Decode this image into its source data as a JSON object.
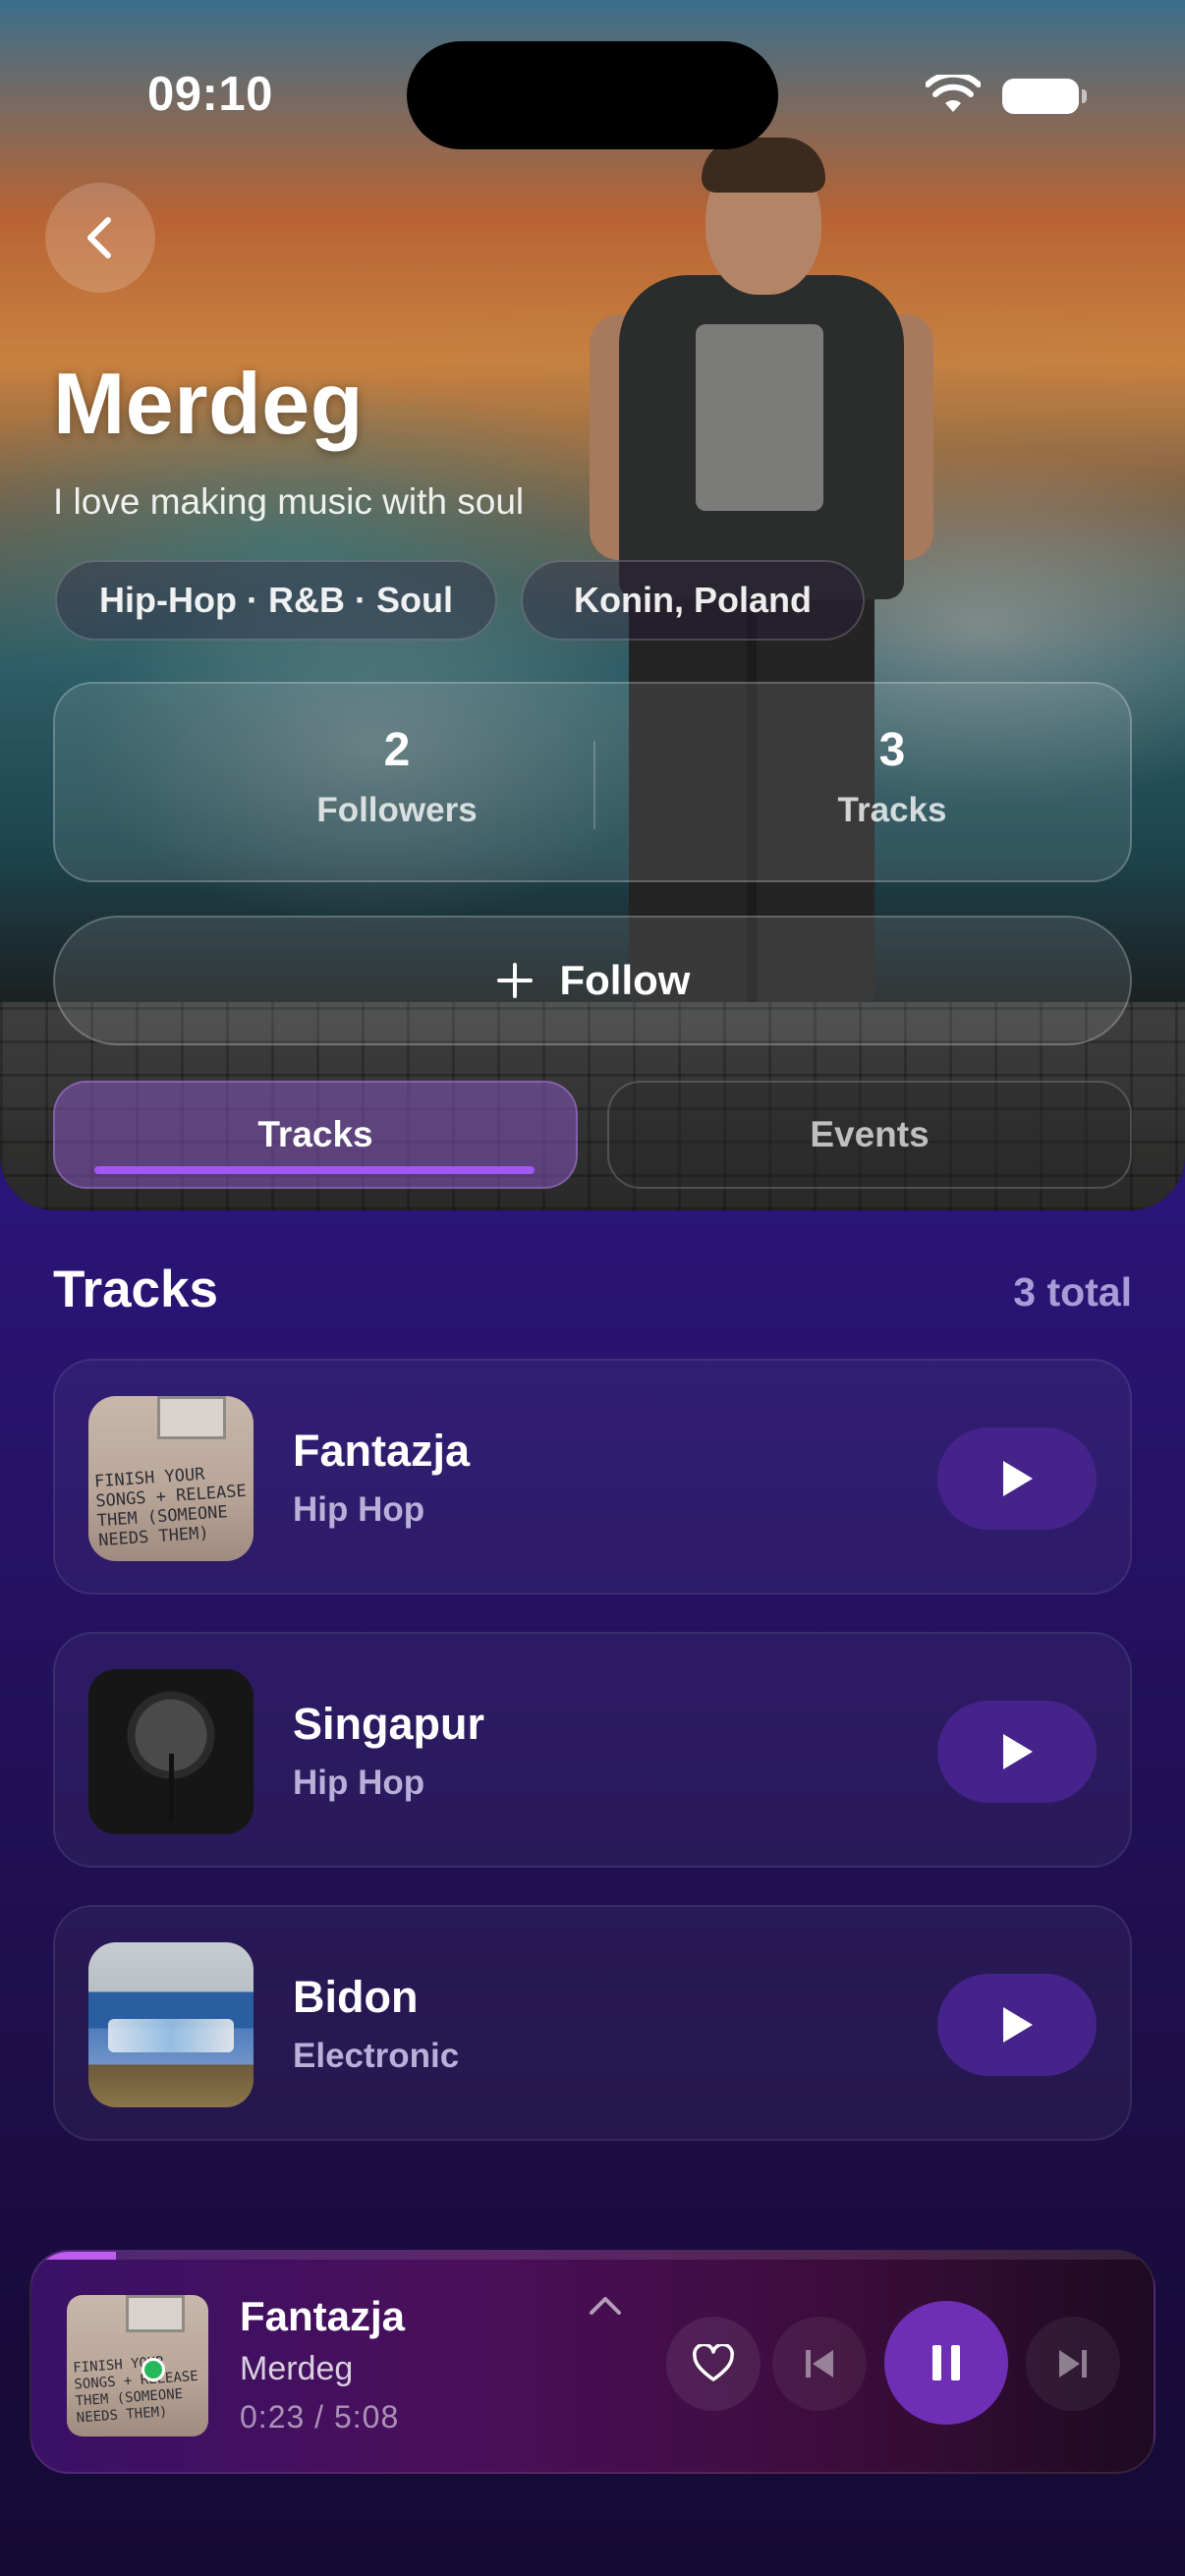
{
  "status_bar": {
    "time": "09:10"
  },
  "artist": {
    "name": "Merdeg",
    "bio": "I love making music with soul",
    "genres": "Hip-Hop · R&B · Soul",
    "location": "Konin, Poland"
  },
  "stats": {
    "followers": {
      "value": "2",
      "label": "Followers"
    },
    "tracks": {
      "value": "3",
      "label": "Tracks"
    }
  },
  "follow_button": {
    "label": "Follow"
  },
  "tabs": [
    {
      "label": "Tracks",
      "active": true
    },
    {
      "label": "Events",
      "active": false
    }
  ],
  "tracks_section": {
    "title": "Tracks",
    "count": "3 total",
    "items": [
      {
        "title": "Fantazja",
        "genre": "Hip Hop"
      },
      {
        "title": "Singapur",
        "genre": "Hip Hop"
      },
      {
        "title": "Bidon",
        "genre": "Electronic"
      }
    ]
  },
  "mini_player": {
    "title": "Fantazja",
    "artist": "Merdeg",
    "time": "0:23 / 5:08",
    "progress": 0.075
  },
  "colors": {
    "accent": "#a257f2",
    "play_button": "#45238a",
    "pause_button": "#6e2fb6"
  },
  "icons": [
    "back-chevron-icon",
    "wifi-icon",
    "battery-icon",
    "plus-icon",
    "play-icon",
    "heart-icon",
    "skip-previous-icon",
    "pause-icon",
    "skip-next-icon",
    "chevron-up-icon"
  ]
}
